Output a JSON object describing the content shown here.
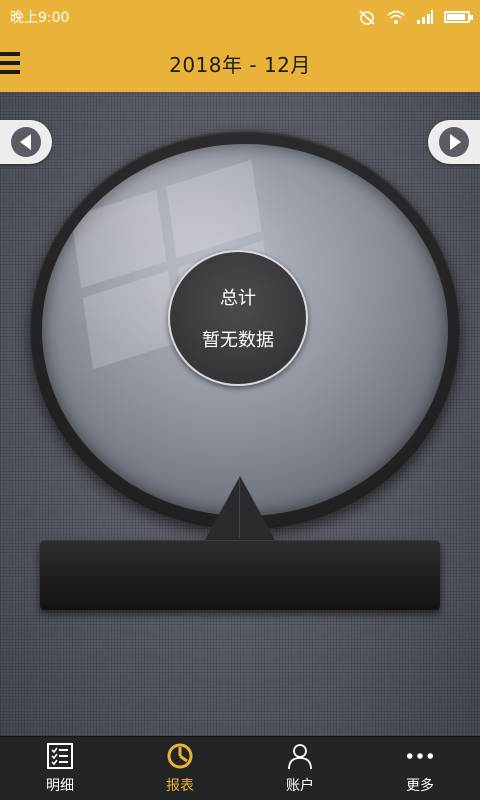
{
  "status_bar": {
    "time": "晚上9:00",
    "battery_level": 0.9
  },
  "header": {
    "title": "2018年 - 12月"
  },
  "summary": {
    "label": "总计",
    "value": "暂无数据"
  },
  "bottom_nav": {
    "items": [
      {
        "label": "明细",
        "icon": "list-icon",
        "active": false
      },
      {
        "label": "报表",
        "icon": "pie-chart-icon",
        "active": true
      },
      {
        "label": "账户",
        "icon": "person-icon",
        "active": false
      },
      {
        "label": "更多",
        "icon": "more-dots-icon",
        "active": false
      }
    ]
  },
  "colors": {
    "accent": "#e9b33a",
    "nav_background": "#232425"
  }
}
